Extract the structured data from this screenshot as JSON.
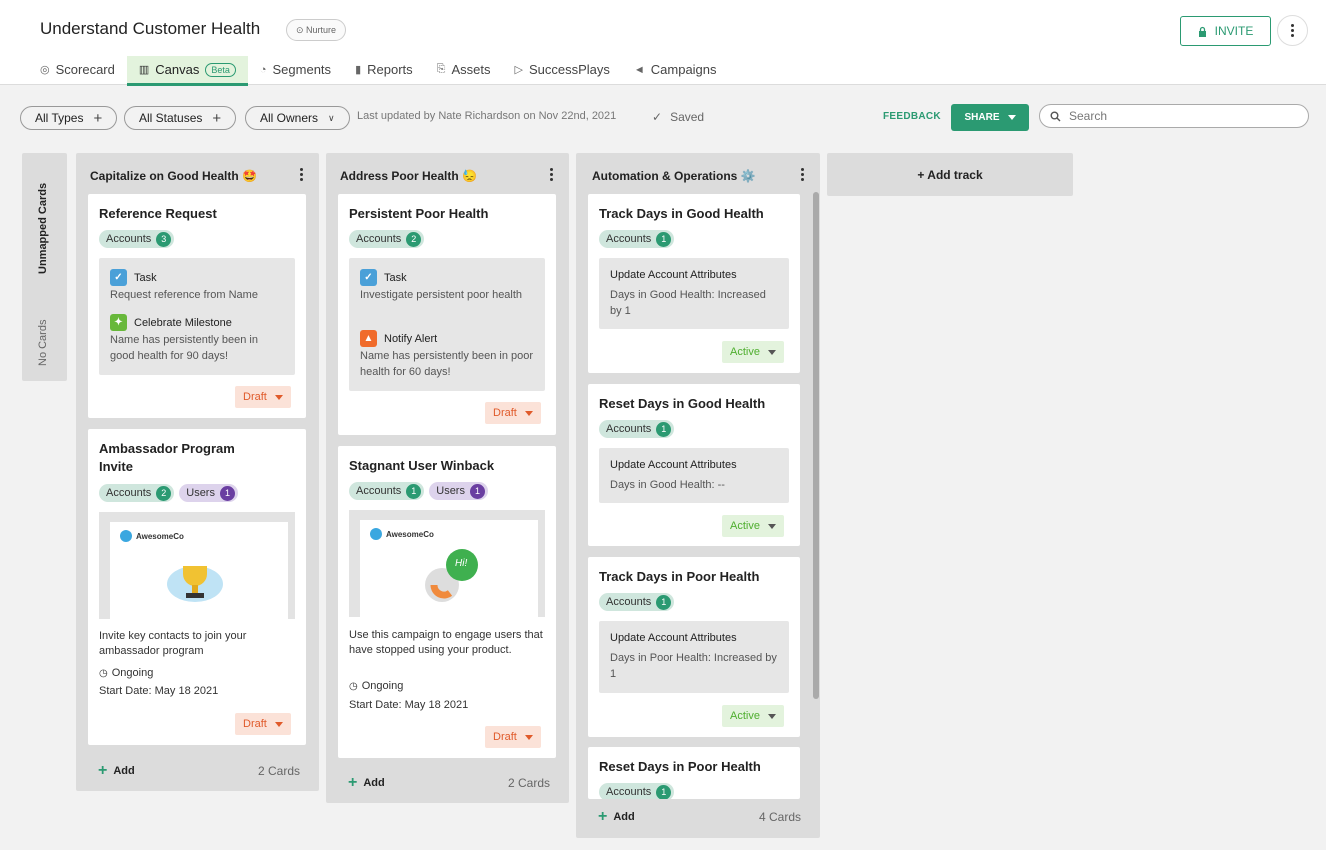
{
  "header": {
    "title": "Understand Customer Health",
    "badge": "Nurture",
    "invite_label": "INVITE"
  },
  "tabs": [
    {
      "label": "Scorecard",
      "icon": "scorecard-icon"
    },
    {
      "label": "Canvas",
      "badge": "Beta",
      "icon": "canvas-icon"
    },
    {
      "label": "Segments",
      "icon": "segments-icon"
    },
    {
      "label": "Reports",
      "icon": "reports-icon"
    },
    {
      "label": "Assets",
      "icon": "assets-icon"
    },
    {
      "label": "SuccessPlays",
      "icon": "play-icon"
    },
    {
      "label": "Campaigns",
      "icon": "megaphone-icon"
    }
  ],
  "toolbar": {
    "types": "All Types",
    "statuses": "All Statuses",
    "owners": "All Owners",
    "updated": "Last updated by Nate Richardson on Nov 22nd, 2021",
    "saved": "Saved",
    "feedback": "FEEDBACK",
    "share": "SHARE",
    "search_placeholder": "Search"
  },
  "unmapped": {
    "label": "Unmapped Cards",
    "empty": "No Cards"
  },
  "tracks": [
    {
      "title": "Capitalize on Good Health 🤩",
      "count": "2 Cards",
      "add": "Add",
      "cards": [
        {
          "title": "Reference Request",
          "accounts": "Accounts",
          "accounts_count": "3",
          "actions": [
            {
              "type": "Task",
              "detail": "Request reference from  Name"
            },
            {
              "type": "Celebrate Milestone",
              "detail": " Name has persistently been in good health for 90 days!"
            }
          ],
          "status": "Draft"
        },
        {
          "title": "Ambassador Program Invite",
          "accounts": "Accounts",
          "accounts_count": "2",
          "users": "Users",
          "users_count": "1",
          "logo": "AwesomeCo",
          "desc": "Invite key contacts to join your ambassador program",
          "ongoing": "Ongoing",
          "start": "Start Date: May 18 2021",
          "status": "Draft"
        }
      ]
    },
    {
      "title": "Address Poor Health 😓",
      "count": "2 Cards",
      "add": "Add",
      "cards": [
        {
          "title": "Persistent Poor Health",
          "accounts": "Accounts",
          "accounts_count": "2",
          "actions": [
            {
              "type": "Task",
              "detail": "Investigate persistent poor health"
            },
            {
              "type": "Notify Alert",
              "detail": " Name has persistently been in poor health for 60 days!"
            }
          ],
          "status": "Draft"
        },
        {
          "title": "Stagnant User Winback",
          "accounts": "Accounts",
          "accounts_count": "1",
          "users": "Users",
          "users_count": "1",
          "logo": "AwesomeCo",
          "bubble": "Hi!",
          "desc": "Use this campaign to engage users that have stopped using your product.",
          "ongoing": "Ongoing",
          "start": "Start Date: May 18 2021",
          "status": "Draft"
        }
      ]
    },
    {
      "title": "Automation & Operations ⚙️",
      "count": "4 Cards",
      "add": "Add",
      "cards": [
        {
          "title": "Track Days in Good Health",
          "accounts": "Accounts",
          "accounts_count": "1",
          "action": "Update Account Attributes",
          "detail": "Days in Good Health: Increased by 1",
          "status": "Active"
        },
        {
          "title": "Reset Days in Good Health",
          "accounts": "Accounts",
          "accounts_count": "1",
          "action": "Update Account Attributes",
          "detail": "Days in Good Health: --",
          "status": "Active"
        },
        {
          "title": "Track Days in Poor Health",
          "accounts": "Accounts",
          "accounts_count": "1",
          "action": "Update Account Attributes",
          "detail": "Days in Poor Health: Increased by 1",
          "status": "Active"
        },
        {
          "title": "Reset Days in Poor Health",
          "accounts": "Accounts",
          "accounts_count": "1"
        }
      ]
    }
  ],
  "add_track": "+ Add track"
}
